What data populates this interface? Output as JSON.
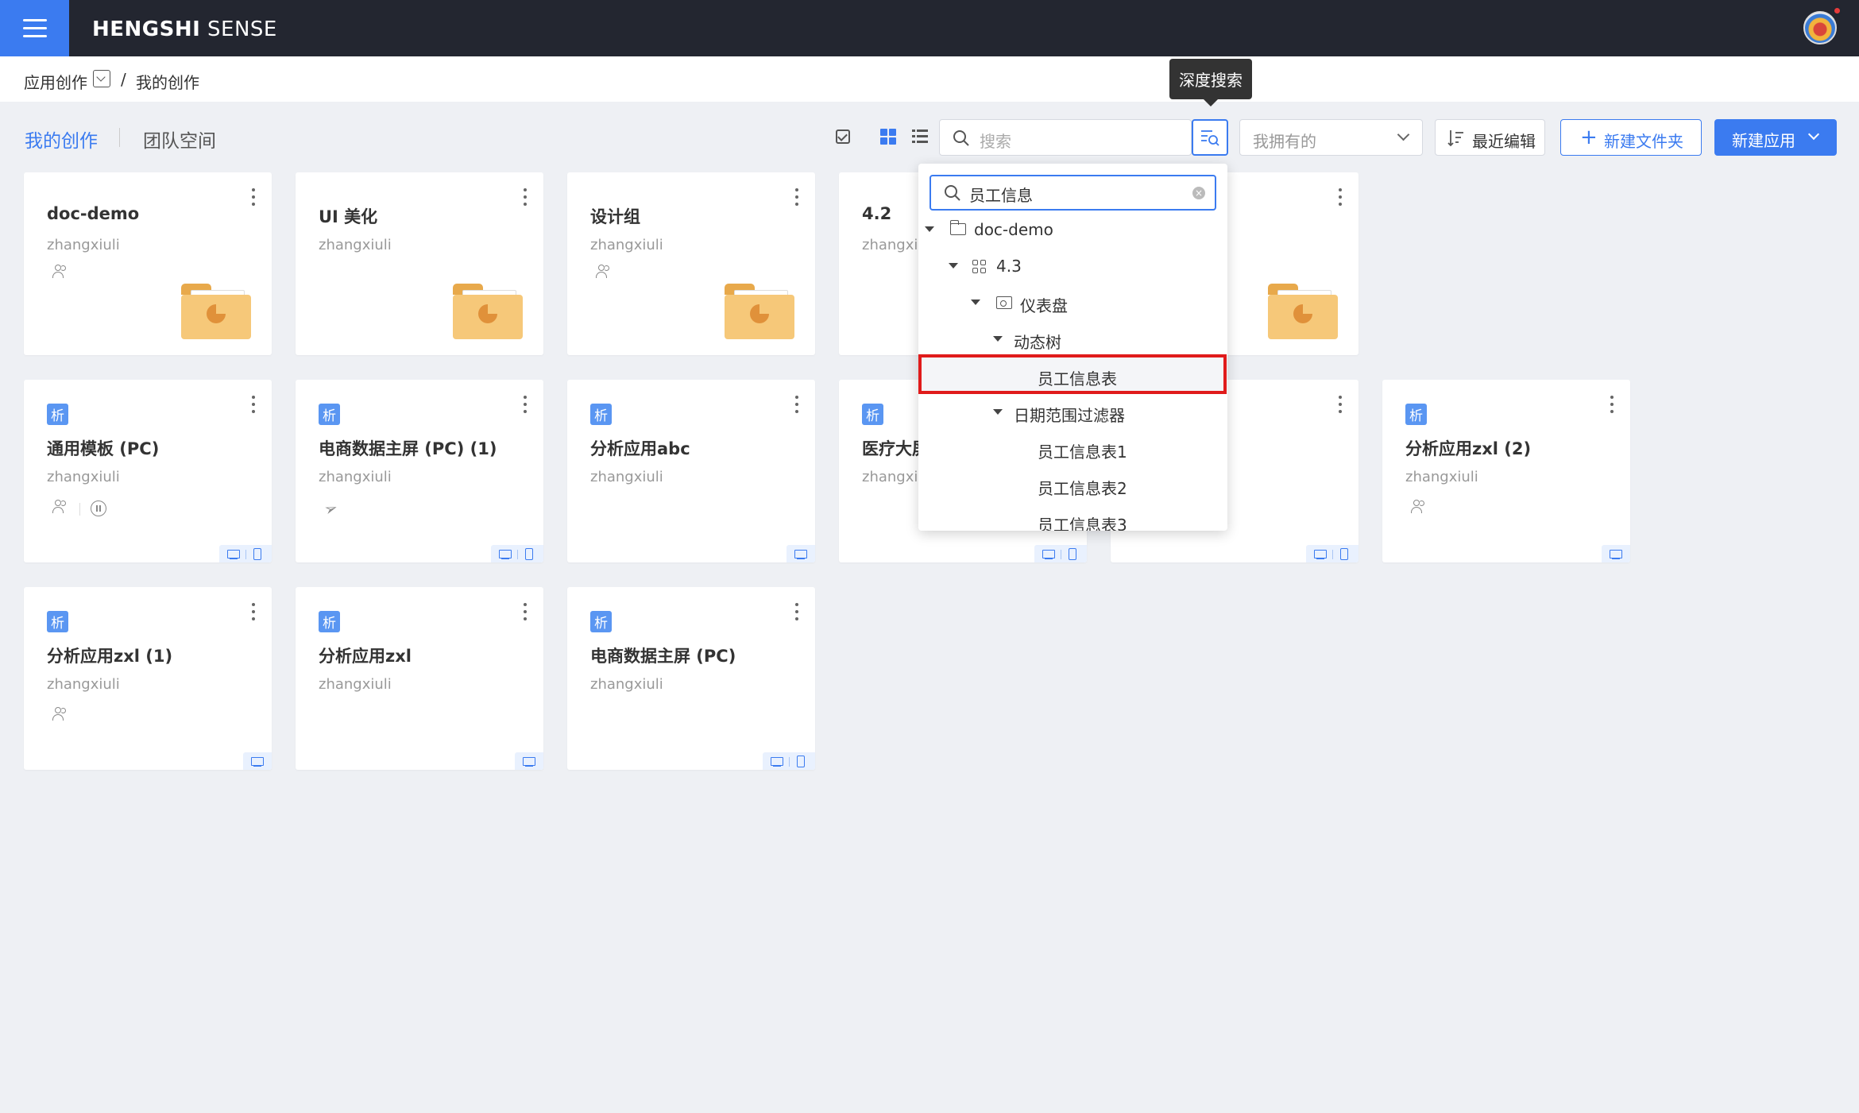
{
  "app": {
    "brand_bold": "HENGSHI",
    "brand_light": " SENSE"
  },
  "breadcrumb": {
    "root": "应用创作",
    "sep": "/",
    "current": "我的创作"
  },
  "tooltip": "深度搜索",
  "tabs": {
    "mine": "我的创作",
    "team": "团队空间"
  },
  "toolbar": {
    "search_placeholder": "搜索",
    "owner_filter": "我拥有的",
    "sort_label": "最近编辑",
    "new_folder": "新建文件夹",
    "new_app": "新建应用"
  },
  "folders": [
    {
      "title": "doc-demo",
      "owner": "zhangxiuli",
      "shared": true
    },
    {
      "title": "UI 美化",
      "owner": "zhangxiuli",
      "shared": false
    },
    {
      "title": "设计组",
      "owner": "zhangxiuli",
      "shared": true
    },
    {
      "title": "4.2",
      "owner": "zhangxiuli",
      "shared": false
    },
    {
      "title": "",
      "owner": "",
      "shared": false
    }
  ],
  "apps": [
    {
      "badge": "析",
      "title": "通用模板 (PC)",
      "owner": "zhangxiuli"
    },
    {
      "badge": "析",
      "title": "电商数据主屏 (PC) (1)",
      "owner": "zhangxiuli"
    },
    {
      "badge": "析",
      "title": "分析应用abc",
      "owner": "zhangxiuli"
    },
    {
      "badge": "析",
      "title": "医疗大屏",
      "owner": "zhangxiuli"
    },
    {
      "badge": "析",
      "title": "",
      "owner": ""
    },
    {
      "badge": "析",
      "title": "分析应用zxl (2)",
      "owner": "zhangxiuli"
    },
    {
      "badge": "析",
      "title": "分析应用zxl (1)",
      "owner": "zhangxiuli"
    },
    {
      "badge": "析",
      "title": "分析应用zxl",
      "owner": "zhangxiuli"
    },
    {
      "badge": "析",
      "title": "电商数据主屏 (PC)",
      "owner": "zhangxiuli"
    }
  ],
  "deep_search": {
    "query": "员工信息",
    "clear": "×",
    "tree": [
      {
        "label": "doc-demo",
        "type": "folder",
        "expanded": true
      },
      {
        "label": "4.3",
        "type": "app",
        "expanded": true
      },
      {
        "label": "仪表盘",
        "type": "dashboard",
        "expanded": true
      },
      {
        "label": "动态树",
        "type": "group",
        "expanded": true
      },
      {
        "label": "员工信息表",
        "type": "chart",
        "selected": true
      },
      {
        "label": "日期范围过滤器",
        "type": "group",
        "expanded": true
      },
      {
        "label": "员工信息表1",
        "type": "chart"
      },
      {
        "label": "员工信息表2",
        "type": "chart"
      },
      {
        "label": "员工信息表3",
        "type": "chart"
      }
    ]
  },
  "colors": {
    "accent": "#3b7bf0",
    "topbar": "#232630",
    "highlight": "#e01b1b",
    "folder": "#f6c879"
  }
}
